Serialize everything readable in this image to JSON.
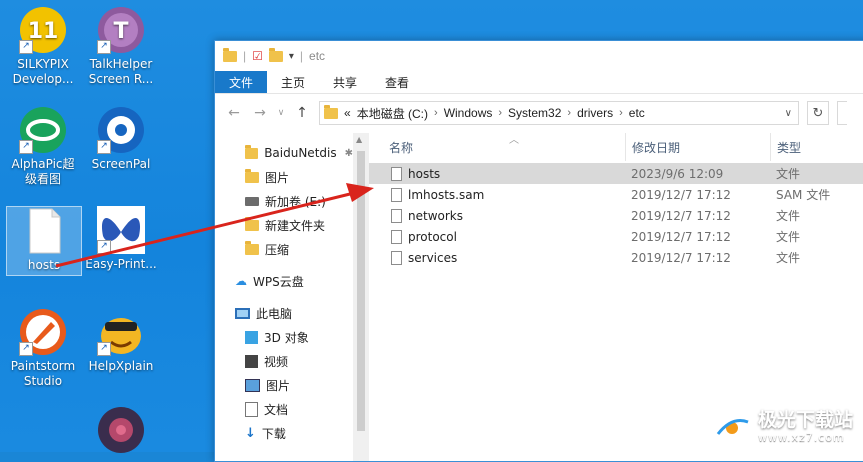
{
  "desktop": {
    "icons": [
      {
        "label1": "SILKYPIX",
        "label2": "Develop...",
        "icon": "silkypix-icon"
      },
      {
        "label1": "TalkHelper",
        "label2": "Screen R...",
        "icon": "talkhelper-icon"
      },
      {
        "label1": "AlphaPic超",
        "label2": "级看图",
        "icon": "alphapic-icon"
      },
      {
        "label1": "ScreenPal",
        "label2": "",
        "icon": "screenpal-icon"
      },
      {
        "label1": "hosts",
        "label2": "",
        "icon": "file-icon"
      },
      {
        "label1": "Easy-Print...",
        "label2": "",
        "icon": "easyprint-icon"
      },
      {
        "label1": "Paintstorm",
        "label2": "Studio",
        "icon": "paintstorm-icon"
      },
      {
        "label1": "HelpXplain",
        "label2": "",
        "icon": "helpxplain-icon"
      }
    ],
    "silkypix_badge": "11",
    "talkhelper_badge": "T"
  },
  "explorer": {
    "title": "etc",
    "ribbon_tabs": [
      "文件",
      "主页",
      "共享",
      "查看"
    ],
    "address": {
      "prefix": "«",
      "crumbs": [
        "本地磁盘 (C:)",
        "Windows",
        "System32",
        "drivers",
        "etc"
      ]
    },
    "nav": [
      {
        "label": "BaiduNetdis",
        "pinned": true,
        "icon": "folder-icon"
      },
      {
        "label": "图片",
        "icon": "folder-icon"
      },
      {
        "label": "新加卷 (E:)",
        "icon": "drive-icon"
      },
      {
        "label": "新建文件夹",
        "icon": "folder-icon"
      },
      {
        "label": "压缩",
        "icon": "folder-icon"
      },
      {
        "label": "WPS云盘",
        "icon": "cloud-icon"
      },
      {
        "label": "此电脑",
        "icon": "computer-icon"
      },
      {
        "label": "3D 对象",
        "icon": "3d-objects-icon"
      },
      {
        "label": "视频",
        "icon": "video-icon"
      },
      {
        "label": "图片",
        "icon": "pictures-icon"
      },
      {
        "label": "文档",
        "icon": "documents-icon"
      },
      {
        "label": "下载",
        "icon": "download-icon"
      }
    ],
    "columns": {
      "name": "名称",
      "date": "修改日期",
      "type": "类型"
    },
    "files": [
      {
        "name": "hosts",
        "date": "2023/9/6 12:09",
        "type": "文件",
        "selected": true
      },
      {
        "name": "lmhosts.sam",
        "date": "2019/12/7 17:12",
        "type": "SAM 文件"
      },
      {
        "name": "networks",
        "date": "2019/12/7 17:12",
        "type": "文件"
      },
      {
        "name": "protocol",
        "date": "2019/12/7 17:12",
        "type": "文件"
      },
      {
        "name": "services",
        "date": "2019/12/7 17:12",
        "type": "文件"
      }
    ]
  },
  "watermark": {
    "name": "极光下载站",
    "url": "www.xz7.com"
  },
  "colors": {
    "accent": "#1979ca",
    "desktop": "#1a86d6",
    "arrow": "#d9241c"
  }
}
